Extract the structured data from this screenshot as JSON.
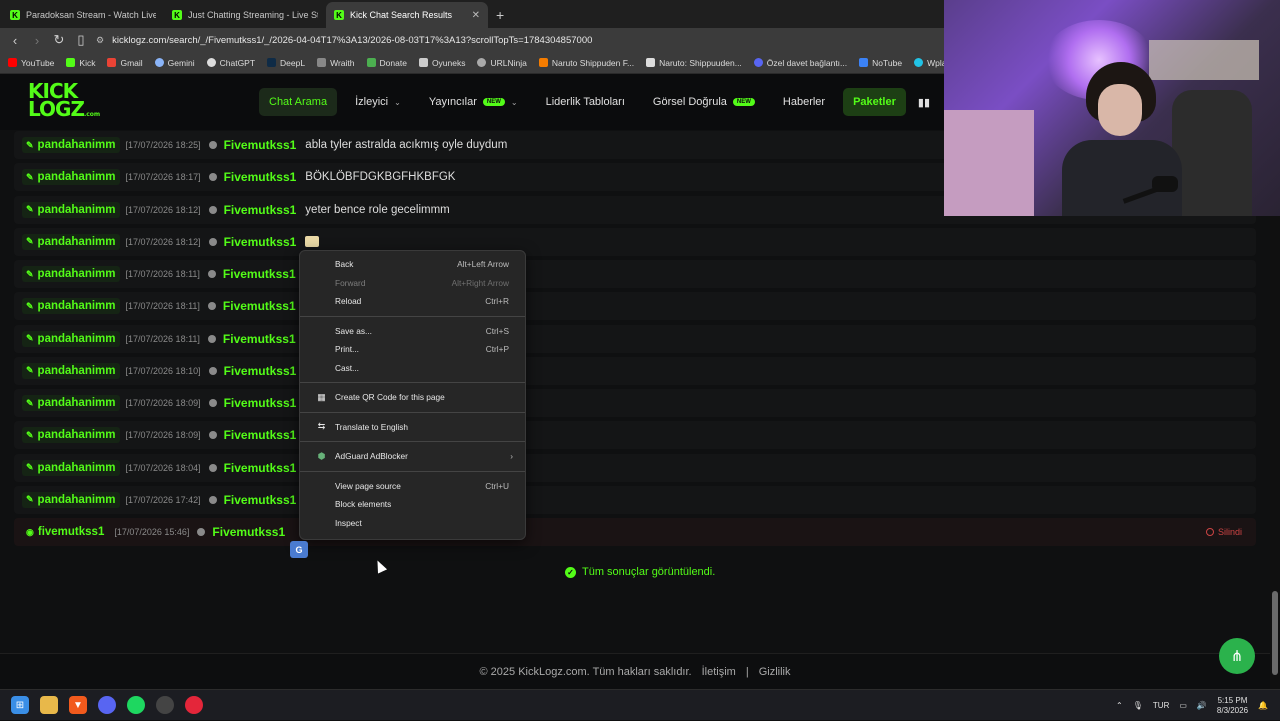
{
  "tabs": [
    {
      "title": "Paradoksan Stream - Watch Live on K",
      "active": false
    },
    {
      "title": "Just Chatting Streaming - Live Stream",
      "active": false
    },
    {
      "title": "Kick Chat Search Results",
      "active": true
    }
  ],
  "url": "kicklogz.com/search/_/Fivemutkss1/_/2026-04-04T17%3A13/2026-08-03T17%3A13?scrollTopTs=1784304857000",
  "bookmarks": [
    "YouTube",
    "Kick",
    "Gmail",
    "Gemini",
    "ChatGPT",
    "DeepL",
    "Wraith",
    "Donate",
    "Oyuneks",
    "URLNinja",
    "Naruto Shippuden F...",
    "Naruto: Shippuuden...",
    "Özel davet bağlantı...",
    "NoTube",
    "Wplace - Pain"
  ],
  "site": {
    "logo_top": "KICK",
    "logo_bottom": "LOGZ",
    "logo_suffix": ".com",
    "nav": {
      "chat_search": "Chat Arama",
      "izleyici": "İzleyici",
      "yayincilar": "Yayıncılar",
      "new_badge": "NEW",
      "leaderboards": "Liderlik Tabloları",
      "visual_verify": "Görsel Doğrula",
      "news": "Haberler",
      "packages": "Paketler"
    }
  },
  "messages": [
    {
      "user": "pandahanimm",
      "time": "[17/07/2026 18:25]",
      "target": "Fivemutkss1",
      "text": "abla tyler astralda acıkmış oyle duydum"
    },
    {
      "user": "pandahanimm",
      "time": "[17/07/2026 18:17]",
      "target": "Fivemutkss1",
      "text": "BÖKLÖBFDGKBGFHKBFGK"
    },
    {
      "user": "pandahanimm",
      "time": "[17/07/2026 18:12]",
      "target": "Fivemutkss1",
      "text": "yeter bence role gecelimmm"
    },
    {
      "user": "pandahanimm",
      "time": "[17/07/2026 18:12]",
      "target": "Fivemutkss1",
      "text": ""
    },
    {
      "user": "pandahanimm",
      "time": "[17/07/2026 18:11]",
      "target": "Fivemutkss1",
      "text": ""
    },
    {
      "user": "pandahanimm",
      "time": "[17/07/2026 18:11]",
      "target": "Fivemutkss1",
      "text": ""
    },
    {
      "user": "pandahanimm",
      "time": "[17/07/2026 18:11]",
      "target": "Fivemutkss1",
      "text": ""
    },
    {
      "user": "pandahanimm",
      "time": "[17/07/2026 18:10]",
      "target": "Fivemutkss1",
      "text": ""
    },
    {
      "user": "pandahanimm",
      "time": "[17/07/2026 18:09]",
      "target": "Fivemutkss1",
      "text": ""
    },
    {
      "user": "pandahanimm",
      "time": "[17/07/2026 18:09]",
      "target": "Fivemutkss1",
      "text": ""
    },
    {
      "user": "pandahanimm",
      "time": "[17/07/2026 18:04]",
      "target": "Fivemutkss1",
      "text": ""
    },
    {
      "user": "pandahanimm",
      "time": "[17/07/2026 17:42]",
      "target": "Fivemutkss1",
      "text": ""
    },
    {
      "user": "fivemutkss1",
      "time": "[17/07/2026 15:46]",
      "target": "Fivemutkss1",
      "text": "",
      "deleted_label": "Silindi"
    }
  ],
  "all_results_text": "Tüm sonuçlar görüntülendi.",
  "footer": {
    "copyright": "© 2025 KickLogz.com. Tüm hakları saklıdır.",
    "contact": "İletişim",
    "sep": "|",
    "privacy": "Gizlilik"
  },
  "context_menu": {
    "back": "Back",
    "back_sc": "Alt+Left Arrow",
    "forward": "Forward",
    "forward_sc": "Alt+Right Arrow",
    "reload": "Reload",
    "reload_sc": "Ctrl+R",
    "save_as": "Save as...",
    "save_as_sc": "Ctrl+S",
    "print": "Print...",
    "print_sc": "Ctrl+P",
    "cast": "Cast...",
    "qr": "Create QR Code for this page",
    "translate": "Translate to English",
    "adguard": "AdGuard AdBlocker",
    "view_source": "View page source",
    "view_source_sc": "Ctrl+U",
    "block": "Block elements",
    "inspect": "Inspect"
  },
  "tray": {
    "lang": "TUR",
    "time": "5:15 PM",
    "date": "8/3/2026"
  }
}
